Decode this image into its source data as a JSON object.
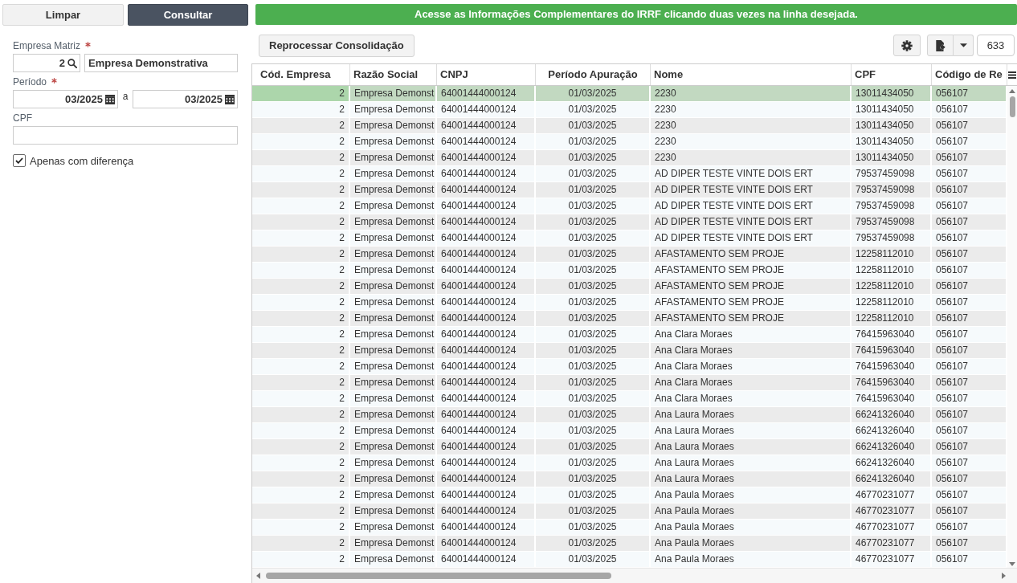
{
  "actions": [
    {
      "label": "Limpar",
      "kind": "secondary"
    },
    {
      "label": "Consultar",
      "kind": "primary"
    }
  ],
  "filters": {
    "empresa_matriz": {
      "label": "Empresa Matriz",
      "required": true,
      "code": "2",
      "name": "Empresa Demonstrativa"
    },
    "periodo": {
      "label": "Período",
      "required": true,
      "from": "03/2025",
      "separator": "a",
      "to": "03/2025"
    },
    "cpf": {
      "label": "CPF"
    },
    "apenas_com_diferenca": {
      "label": "Apenas com diferença",
      "checked": true
    }
  },
  "banner": "Acesse as Informações Complementares do IRRF clicando duas vezes na linha desejada.",
  "toolbar": {
    "reprocess_button": "Reprocessar Consolidação",
    "record_count": "633"
  },
  "table": {
    "columns": [
      {
        "label": "Cód. Empresa"
      },
      {
        "label": "Razão Social"
      },
      {
        "label": "CNPJ"
      },
      {
        "label": "Período Apuração"
      },
      {
        "label": "Nome"
      },
      {
        "label": "CPF"
      },
      {
        "label": "Código de Re"
      }
    ],
    "rows": [
      {
        "selected": true,
        "cells": [
          "2",
          "Empresa Demonst",
          "64001444000124",
          "01/03/2025",
          "2230",
          "13011434050",
          "056107"
        ]
      },
      {
        "selected": false,
        "cells": [
          "2",
          "Empresa Demonst",
          "64001444000124",
          "01/03/2025",
          "2230",
          "13011434050",
          "056107"
        ]
      },
      {
        "selected": false,
        "cells": [
          "2",
          "Empresa Demonst",
          "64001444000124",
          "01/03/2025",
          "2230",
          "13011434050",
          "056107"
        ]
      },
      {
        "selected": false,
        "cells": [
          "2",
          "Empresa Demonst",
          "64001444000124",
          "01/03/2025",
          "2230",
          "13011434050",
          "056107"
        ]
      },
      {
        "selected": false,
        "cells": [
          "2",
          "Empresa Demonst",
          "64001444000124",
          "01/03/2025",
          "2230",
          "13011434050",
          "056107"
        ]
      },
      {
        "selected": false,
        "cells": [
          "2",
          "Empresa Demonst",
          "64001444000124",
          "01/03/2025",
          "AD DIPER TESTE VINTE DOIS ERT",
          "79537459098",
          "056107"
        ]
      },
      {
        "selected": false,
        "cells": [
          "2",
          "Empresa Demonst",
          "64001444000124",
          "01/03/2025",
          "AD DIPER TESTE VINTE DOIS ERT",
          "79537459098",
          "056107"
        ]
      },
      {
        "selected": false,
        "cells": [
          "2",
          "Empresa Demonst",
          "64001444000124",
          "01/03/2025",
          "AD DIPER TESTE VINTE DOIS ERT",
          "79537459098",
          "056107"
        ]
      },
      {
        "selected": false,
        "cells": [
          "2",
          "Empresa Demonst",
          "64001444000124",
          "01/03/2025",
          "AD DIPER TESTE VINTE DOIS ERT",
          "79537459098",
          "056107"
        ]
      },
      {
        "selected": false,
        "cells": [
          "2",
          "Empresa Demonst",
          "64001444000124",
          "01/03/2025",
          "AD DIPER TESTE VINTE DOIS ERT",
          "79537459098",
          "056107"
        ]
      },
      {
        "selected": false,
        "cells": [
          "2",
          "Empresa Demonst",
          "64001444000124",
          "01/03/2025",
          "AFASTAMENTO SEM PROJE",
          "12258112010",
          "056107"
        ]
      },
      {
        "selected": false,
        "cells": [
          "2",
          "Empresa Demonst",
          "64001444000124",
          "01/03/2025",
          "AFASTAMENTO SEM PROJE",
          "12258112010",
          "056107"
        ]
      },
      {
        "selected": false,
        "cells": [
          "2",
          "Empresa Demonst",
          "64001444000124",
          "01/03/2025",
          "AFASTAMENTO SEM PROJE",
          "12258112010",
          "056107"
        ]
      },
      {
        "selected": false,
        "cells": [
          "2",
          "Empresa Demonst",
          "64001444000124",
          "01/03/2025",
          "AFASTAMENTO SEM PROJE",
          "12258112010",
          "056107"
        ]
      },
      {
        "selected": false,
        "cells": [
          "2",
          "Empresa Demonst",
          "64001444000124",
          "01/03/2025",
          "AFASTAMENTO SEM PROJE",
          "12258112010",
          "056107"
        ]
      },
      {
        "selected": false,
        "cells": [
          "2",
          "Empresa Demonst",
          "64001444000124",
          "01/03/2025",
          "Ana Clara Moraes",
          "76415963040",
          "056107"
        ]
      },
      {
        "selected": false,
        "cells": [
          "2",
          "Empresa Demonst",
          "64001444000124",
          "01/03/2025",
          "Ana Clara Moraes",
          "76415963040",
          "056107"
        ]
      },
      {
        "selected": false,
        "cells": [
          "2",
          "Empresa Demonst",
          "64001444000124",
          "01/03/2025",
          "Ana Clara Moraes",
          "76415963040",
          "056107"
        ]
      },
      {
        "selected": false,
        "cells": [
          "2",
          "Empresa Demonst",
          "64001444000124",
          "01/03/2025",
          "Ana Clara Moraes",
          "76415963040",
          "056107"
        ]
      },
      {
        "selected": false,
        "cells": [
          "2",
          "Empresa Demonst",
          "64001444000124",
          "01/03/2025",
          "Ana Clara Moraes",
          "76415963040",
          "056107"
        ]
      },
      {
        "selected": false,
        "cells": [
          "2",
          "Empresa Demonst",
          "64001444000124",
          "01/03/2025",
          "Ana Laura Moraes",
          "66241326040",
          "056107"
        ]
      },
      {
        "selected": false,
        "cells": [
          "2",
          "Empresa Demonst",
          "64001444000124",
          "01/03/2025",
          "Ana Laura Moraes",
          "66241326040",
          "056107"
        ]
      },
      {
        "selected": false,
        "cells": [
          "2",
          "Empresa Demonst",
          "64001444000124",
          "01/03/2025",
          "Ana Laura Moraes",
          "66241326040",
          "056107"
        ]
      },
      {
        "selected": false,
        "cells": [
          "2",
          "Empresa Demonst",
          "64001444000124",
          "01/03/2025",
          "Ana Laura Moraes",
          "66241326040",
          "056107"
        ]
      },
      {
        "selected": false,
        "cells": [
          "2",
          "Empresa Demonst",
          "64001444000124",
          "01/03/2025",
          "Ana Laura Moraes",
          "66241326040",
          "056107"
        ]
      },
      {
        "selected": false,
        "cells": [
          "2",
          "Empresa Demonst",
          "64001444000124",
          "01/03/2025",
          "Ana Paula Moraes",
          "46770231077",
          "056107"
        ]
      },
      {
        "selected": false,
        "cells": [
          "2",
          "Empresa Demonst",
          "64001444000124",
          "01/03/2025",
          "Ana Paula Moraes",
          "46770231077",
          "056107"
        ]
      },
      {
        "selected": false,
        "cells": [
          "2",
          "Empresa Demonst",
          "64001444000124",
          "01/03/2025",
          "Ana Paula Moraes",
          "46770231077",
          "056107"
        ]
      },
      {
        "selected": false,
        "cells": [
          "2",
          "Empresa Demonst",
          "64001444000124",
          "01/03/2025",
          "Ana Paula Moraes",
          "46770231077",
          "056107"
        ]
      },
      {
        "selected": false,
        "cells": [
          "2",
          "Empresa Demonst",
          "64001444000124",
          "01/03/2025",
          "Ana Paula Moraes",
          "46770231077",
          "056107"
        ]
      }
    ]
  }
}
